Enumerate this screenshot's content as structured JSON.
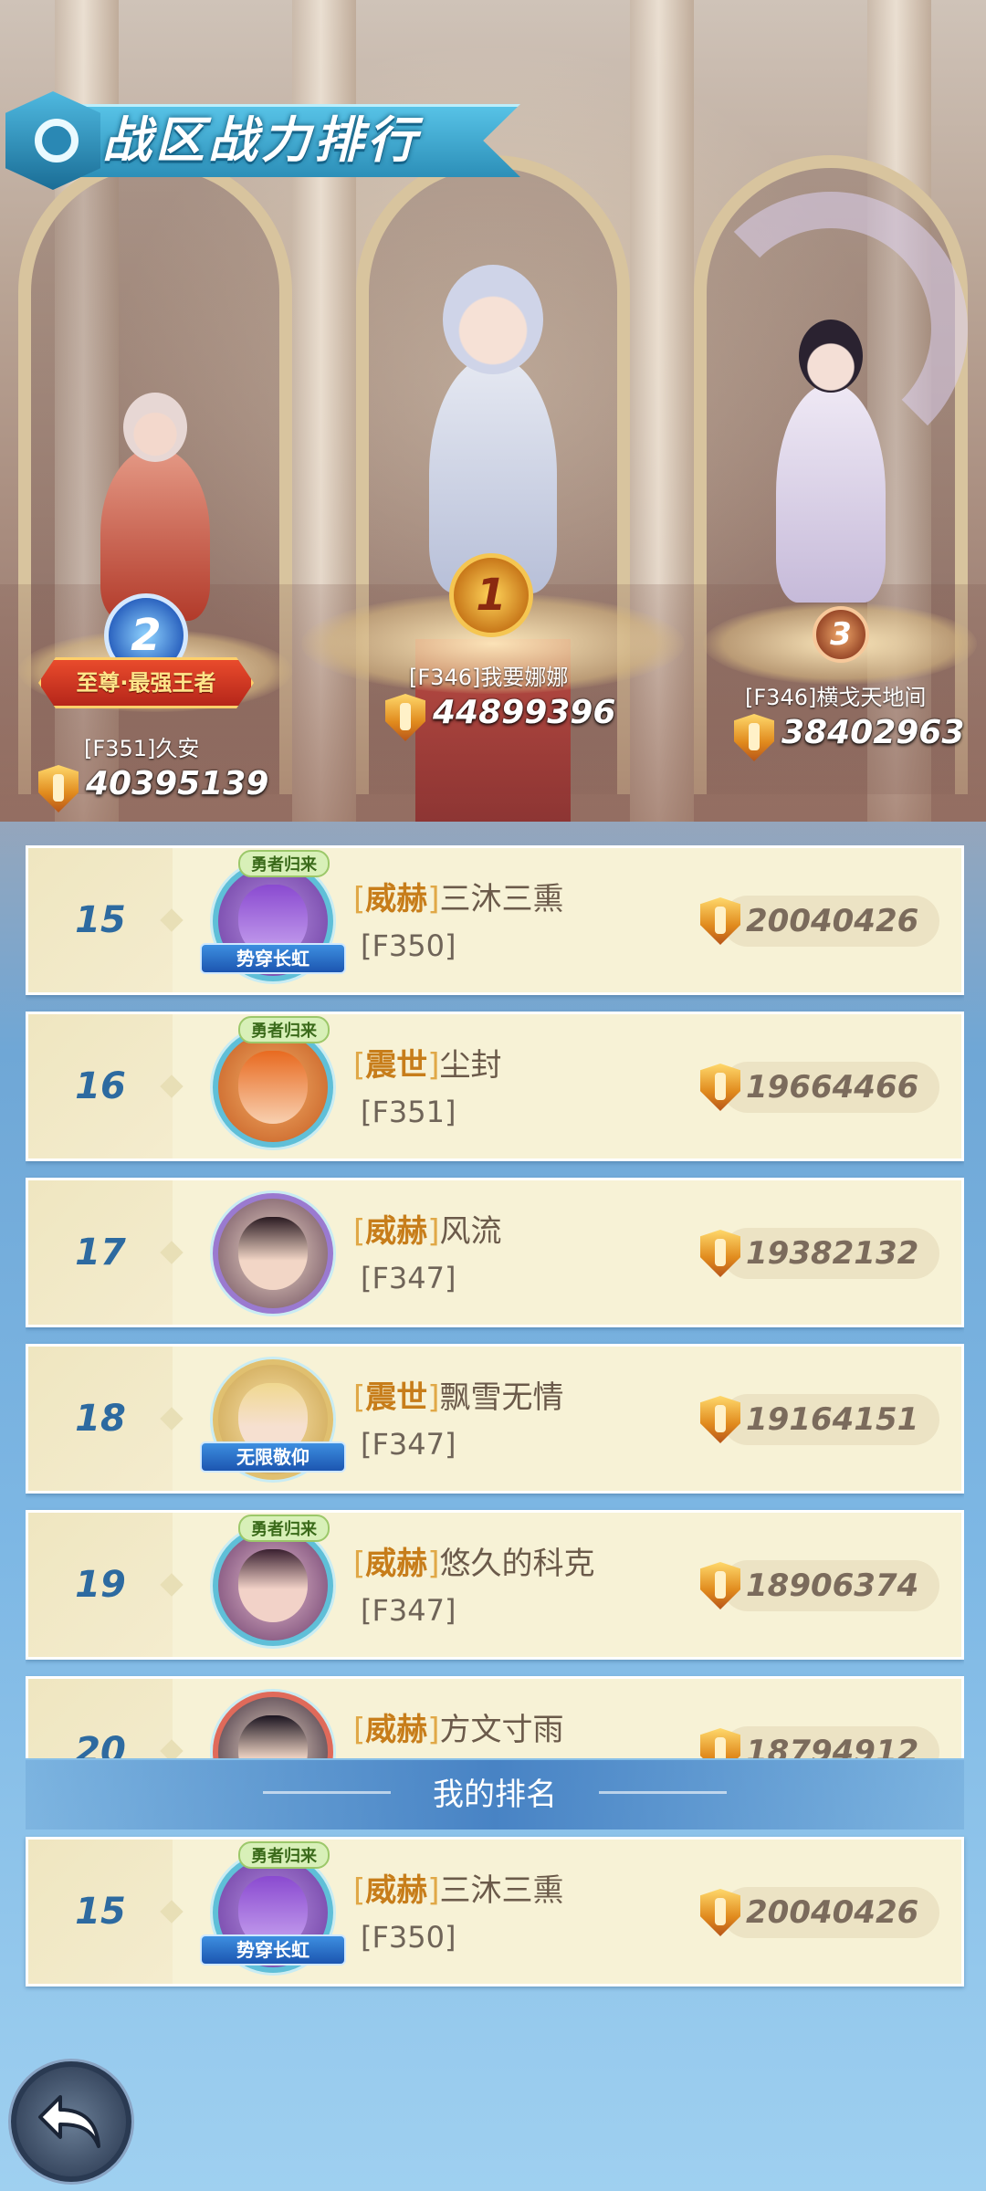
{
  "title": "战区战力排行",
  "podium": {
    "first": {
      "rank": "1",
      "name": "[F346]我要娜娜",
      "power": "44899396"
    },
    "second": {
      "rank": "2",
      "name": "[F351]久安",
      "power": "40395139",
      "title_badge": "至尊·最强王者"
    },
    "third": {
      "rank": "3",
      "name": "[F346]横戈天地间",
      "power": "38402963"
    }
  },
  "rows": [
    {
      "rank": "15",
      "guild": "威赫",
      "name": "三沐三熏",
      "server": "[F350]",
      "power": "20040426",
      "tag": "势穿长虹",
      "crest": "勇者归来"
    },
    {
      "rank": "16",
      "guild": "震世",
      "name": "尘封",
      "server": "[F351]",
      "power": "19664466",
      "crest": "勇者归来"
    },
    {
      "rank": "17",
      "guild": "威赫",
      "name": "风流",
      "server": "[F347]",
      "power": "19382132"
    },
    {
      "rank": "18",
      "guild": "震世",
      "name": "飘雪无情",
      "server": "[F347]",
      "power": "19164151",
      "tag": "无限敬仰"
    },
    {
      "rank": "19",
      "guild": "威赫",
      "name": "悠久的科克",
      "server": "[F347]",
      "power": "18906374",
      "crest": "勇者归来"
    },
    {
      "rank": "20",
      "guild": "威赫",
      "name": "方文寸雨",
      "server": "",
      "power": "18794912"
    }
  ],
  "my_rank": {
    "header": "我的排名",
    "rank": "15",
    "guild": "威赫",
    "name": "三沐三熏",
    "server": "[F350]",
    "power": "20040426",
    "tag": "势穿长虹",
    "crest": "勇者归来"
  },
  "colors": {
    "accent": "#2d6aa0",
    "guild": "#c77d1a",
    "row_bg": "#f7f2d6"
  },
  "icons": {
    "back": "back-arrow-icon",
    "power": "power-shield-icon",
    "title": "crest-emblem-icon"
  }
}
